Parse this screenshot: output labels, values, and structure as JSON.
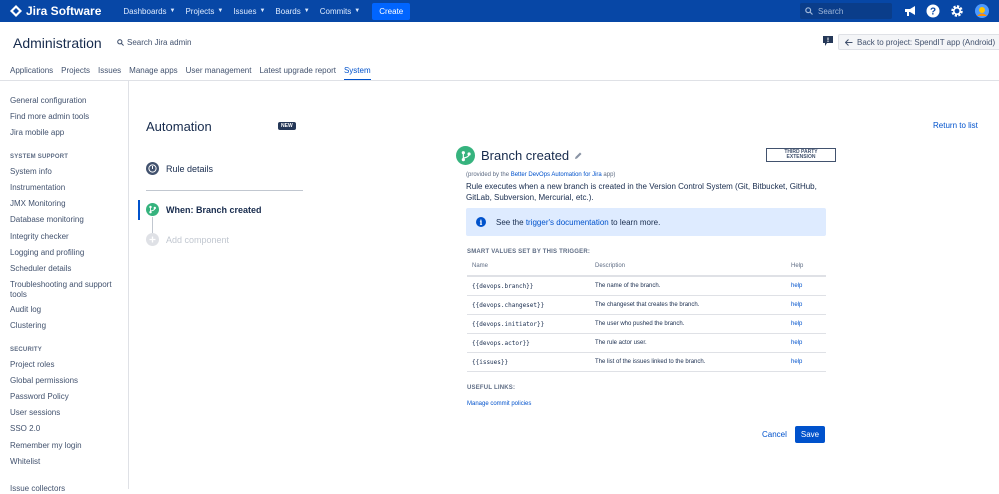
{
  "topnav": {
    "logo_text": "Jira Software",
    "items": [
      {
        "label": "Dashboards"
      },
      {
        "label": "Projects"
      },
      {
        "label": "Issues"
      },
      {
        "label": "Boards"
      },
      {
        "label": "Commits"
      }
    ],
    "create_label": "Create",
    "search_placeholder": "Search",
    "icons": [
      "megaphone-icon",
      "help-icon",
      "settings-icon",
      "user-avatar"
    ]
  },
  "admin": {
    "title": "Administration",
    "search_label": "Search Jira admin",
    "back_label": "Back to project: SpendIT app (Android)",
    "tabs": [
      {
        "label": "Applications"
      },
      {
        "label": "Projects"
      },
      {
        "label": "Issues"
      },
      {
        "label": "Manage apps"
      },
      {
        "label": "User management"
      },
      {
        "label": "Latest upgrade report"
      },
      {
        "label": "System",
        "active": true
      }
    ]
  },
  "sidebar": {
    "top_links": [
      "General configuration",
      "Find more admin tools",
      "Jira mobile app"
    ],
    "system_support_heading": "SYSTEM SUPPORT",
    "system_support_links": [
      "System info",
      "Instrumentation",
      "JMX Monitoring",
      "Database monitoring",
      "Integrity checker",
      "Logging and profiling",
      "Scheduler details",
      "Troubleshooting and support tools",
      "Audit log",
      "Clustering"
    ],
    "security_heading": "SECURITY",
    "security_links": [
      "Project roles",
      "Global permissions",
      "Password Policy",
      "User sessions",
      "SSO 2.0",
      "Remember my login",
      "Whitelist"
    ],
    "cut_off_link": "Issue collectors"
  },
  "automation": {
    "title": "Automation",
    "new_badge": "NEW",
    "rule_details": "Rule details",
    "when_trigger": "When: Branch created",
    "add_component": "Add component",
    "return_link": "Return to list"
  },
  "detail": {
    "title": "Branch created",
    "third_party_line1": "THIRD PARTY",
    "third_party_line2": "EXTENSION",
    "provided_prefix": "(provided by the ",
    "provided_link": "Better DevOps Automation for Jira",
    "provided_suffix": " app)",
    "description": "Rule executes when a new branch is created in the Version Control System (Git, Bitbucket, GitHub, GitLab, Subversion, Mercurial, etc.).",
    "info_prefix": "See the ",
    "info_link": "trigger's documentation",
    "info_suffix": " to learn more.",
    "smart_values_heading": "SMART VALUES SET BY THIS TRIGGER:",
    "table_headers": {
      "name": "Name",
      "description": "Description",
      "help": "Help"
    },
    "rows": [
      {
        "name": "{{devops.branch}}",
        "description": "The name of the branch.",
        "help": "help"
      },
      {
        "name": "{{devops.changeset}}",
        "description": "The changeset that creates the branch.",
        "help": "help"
      },
      {
        "name": "{{devops.initiator}}",
        "description": "The user who pushed the branch.",
        "help": "help"
      },
      {
        "name": "{{devops.actor}}",
        "description": "The rule actor user.",
        "help": "help"
      },
      {
        "name": "{{issues}}",
        "description": "The list of the issues linked to the branch.",
        "help": "help"
      }
    ],
    "useful_links_heading": "USEFUL LINKS:",
    "useful_link": "Manage commit policies",
    "cancel_label": "Cancel",
    "save_label": "Save"
  },
  "colors": {
    "nav_bg": "#0747a6",
    "primary": "#0052cc",
    "trigger_green": "#36b37e",
    "info_bg": "#deebff"
  }
}
